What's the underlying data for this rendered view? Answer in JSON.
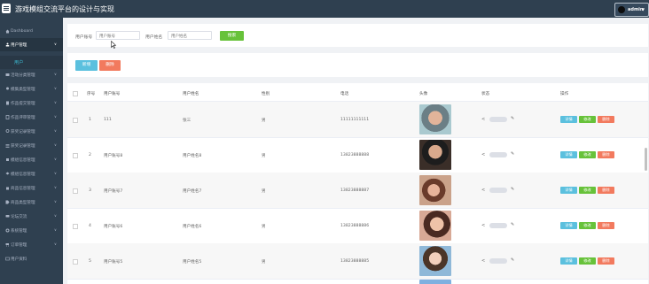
{
  "app": {
    "title": "游戏模组交流平台的设计与实现",
    "admin_label": "admin"
  },
  "sidebar": {
    "items": [
      {
        "label": "Dashboard",
        "icon": "home-icon"
      },
      {
        "label": "用户管理",
        "icon": "users-icon",
        "open": true
      },
      {
        "label": "活动分类管理",
        "icon": "folder-icon"
      },
      {
        "label": "模集类型管理",
        "icon": "pin-icon"
      },
      {
        "label": "作品提交管理",
        "icon": "doc-icon"
      },
      {
        "label": "作品评审管理",
        "icon": "clipboard-icon"
      },
      {
        "label": "获奖记录管理",
        "icon": "award-icon"
      },
      {
        "label": "获奖记录管理",
        "icon": "list-icon"
      },
      {
        "label": "模组信息管理",
        "icon": "cube-icon"
      },
      {
        "label": "模组信息管理",
        "icon": "layers-icon"
      },
      {
        "label": "商品信息管理",
        "icon": "bag-icon"
      },
      {
        "label": "商品类型管理",
        "icon": "tag-icon"
      },
      {
        "label": "论坛交流",
        "icon": "chat-icon"
      },
      {
        "label": "系统管理",
        "icon": "gear-icon"
      },
      {
        "label": "订单管理",
        "icon": "cart-icon"
      },
      {
        "label": "用户资料",
        "icon": "profile-icon"
      }
    ],
    "sub_item": "用户"
  },
  "search": {
    "account_label": "用户账号",
    "account_placeholder": "用户账号",
    "name_label": "用户姓名",
    "name_placeholder": "用户姓名",
    "button": "搜索"
  },
  "actions": {
    "add": "新增",
    "delete": "删除"
  },
  "table": {
    "headers": [
      "序号",
      "用户账号",
      "用户姓名",
      "性别",
      "电话",
      "头像",
      "状态",
      "操作"
    ],
    "rows": [
      {
        "index": "1",
        "account": "111",
        "name": "张三",
        "gender": "男",
        "phone": "11111111111"
      },
      {
        "index": "2",
        "account": "用户账号8",
        "name": "用户姓名8",
        "gender": "男",
        "phone": "13823888888"
      },
      {
        "index": "3",
        "account": "用户账号7",
        "name": "用户姓名7",
        "gender": "男",
        "phone": "13823888887"
      },
      {
        "index": "4",
        "account": "用户账号6",
        "name": "用户姓名6",
        "gender": "男",
        "phone": "13823888886"
      },
      {
        "index": "5",
        "account": "用户账号5",
        "name": "用户姓名5",
        "gender": "男",
        "phone": "13823888885"
      }
    ],
    "row_actions": {
      "detail": "详情",
      "edit": "修改",
      "delete": "删除"
    }
  },
  "colors": {
    "sidebar_bg": "#2f4050",
    "accent_teal": "#5bc0de",
    "success_green": "#67c23a",
    "danger_red": "#f27a5e",
    "active_sub": "#3cbcd4"
  }
}
